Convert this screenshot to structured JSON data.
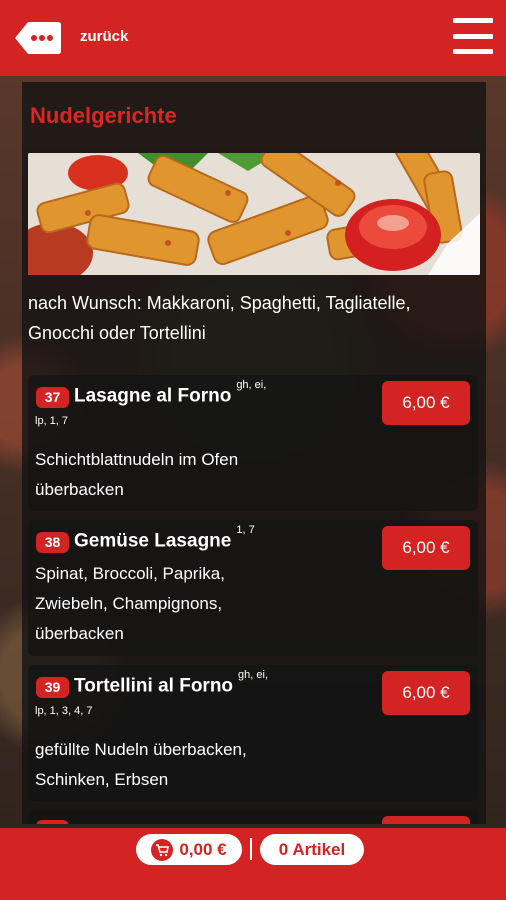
{
  "header": {
    "back_label": "zurück",
    "accent_color": "#d42323"
  },
  "section": {
    "title": "Nudelgerichte",
    "intro": "nach Wunsch: Makkaroni, Spaghetti, Tagliatelle, Gnocchi oder Tortellini"
  },
  "items": [
    {
      "number": "37",
      "name": "Lasagne al Forno",
      "allergens_inline": "gh, ei,",
      "allergens_line": "lp, 1, 7",
      "description_lines": [
        "Schichtblattnudeln im Ofen",
        "überbacken"
      ],
      "price": "6,00 €"
    },
    {
      "number": "38",
      "name": "Gemüse Lasagne",
      "allergens_inline": "1, 7",
      "allergens_line": "",
      "description_lines": [
        "Spinat, Broccoli, Paprika,",
        "Zwiebeln, Champignons,",
        "überbacken"
      ],
      "price": "6,00 €"
    },
    {
      "number": "39",
      "name": "Tortellini al Forno",
      "allergens_inline": "gh, ei,",
      "allergens_line": "lp, 1, 3, 4, 7",
      "description_lines": [
        "gefüllte Nudeln überbacken,",
        "Schinken, Erbsen"
      ],
      "price": "6,00 €"
    }
  ],
  "footer": {
    "cart_total": "0,00 €",
    "items_count": "0 Artikel"
  },
  "icons": {
    "back": "back-dots-icon",
    "menu": "hamburger-menu-icon",
    "cart": "cart-icon"
  }
}
